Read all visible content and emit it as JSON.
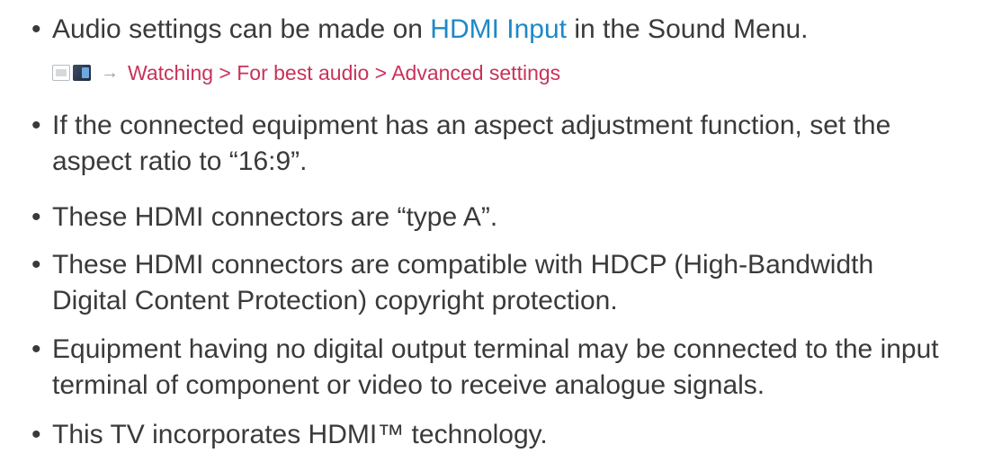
{
  "bullets": [
    {
      "before": "Audio settings can be made on ",
      "link": "HDMI Input",
      "after": " in the Sound Menu."
    },
    {
      "line1": "If the connected equipment has an aspect adjustment function, set the",
      "line2": "aspect ratio to “16:9”."
    },
    {
      "line1": "These HDMI connectors are “type A”."
    },
    {
      "line1": "These HDMI connectors are compatible with HDCP (High-Bandwidth",
      "line2": "Digital Content Protection) copyright protection."
    },
    {
      "line1": "Equipment having no digital output terminal may be connected to the input",
      "line2": "terminal of component or video to receive analogue signals."
    },
    {
      "line1": "This TV incorporates HDMI™ technology."
    }
  ],
  "bullet_symbol": "•",
  "nav": {
    "icon": "menu-icon",
    "arrow": "→",
    "path": "Watching > For best audio > Advanced settings"
  },
  "colors": {
    "text": "#3a3a3a",
    "link": "#1e88c8",
    "nav_path": "#c8325a"
  }
}
